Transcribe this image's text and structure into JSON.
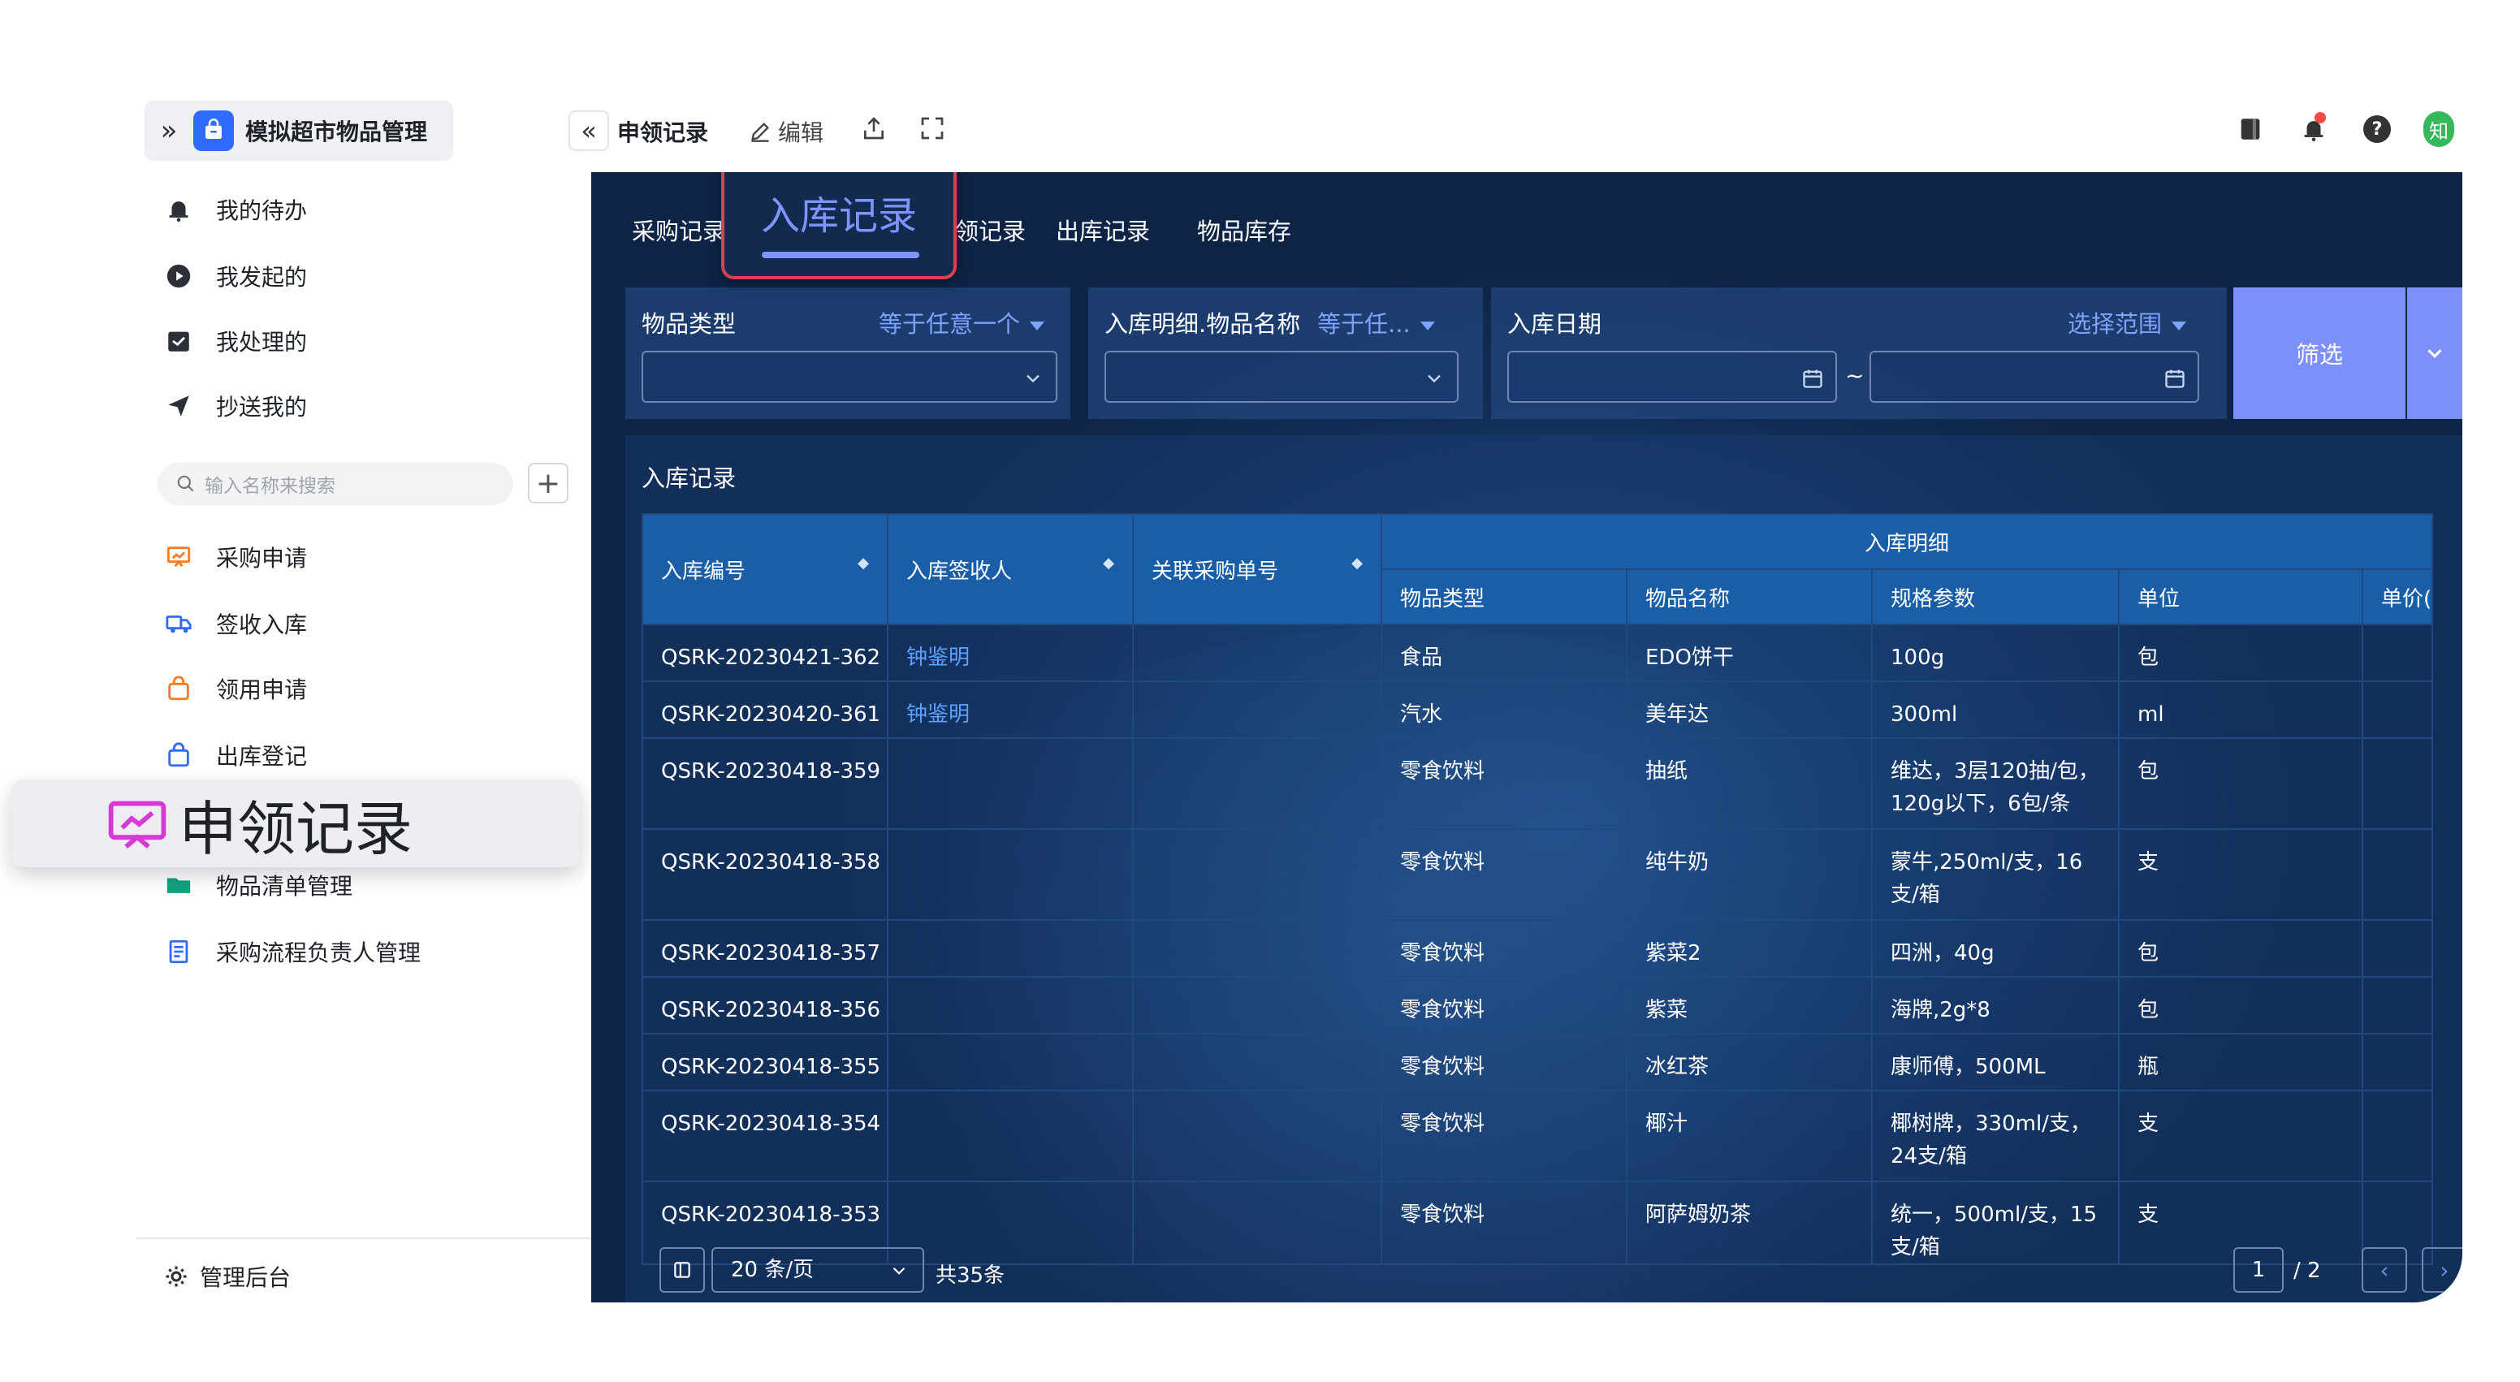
{
  "app": {
    "title": "模拟超市物品管理",
    "expand_icon": "double-chevron-right-icon"
  },
  "sidebar": {
    "top_items": [
      {
        "label": "我的待办",
        "icon": "bell-icon"
      },
      {
        "label": "我发起的",
        "icon": "play-circle-icon"
      },
      {
        "label": "我处理的",
        "icon": "inbox-check-icon"
      },
      {
        "label": "抄送我的",
        "icon": "send-icon"
      }
    ],
    "search_placeholder": "输入名称来搜索",
    "add_label": "+",
    "menu_items": [
      {
        "label": "采购申请",
        "icon": "presentation-icon"
      },
      {
        "label": "签收入库",
        "icon": "truck-icon"
      },
      {
        "label": "领用申请",
        "icon": "bag-icon"
      },
      {
        "label": "出库登记",
        "icon": "bag-out-icon"
      },
      {
        "label": "物品清单管理",
        "icon": "folder-icon"
      },
      {
        "label": "采购流程负责人管理",
        "icon": "document-icon"
      }
    ],
    "highlight_popup": {
      "label": "申领记录",
      "icon": "monitor-chart-icon"
    },
    "admin_label": "管理后台"
  },
  "toolbar": {
    "collapse_icon": "double-chevron-left-icon",
    "page_title": "申领记录",
    "edit_label": "编辑",
    "share_icon": "share-icon",
    "fullscreen_icon": "fullscreen-icon",
    "right_icons": [
      "book-icon",
      "notification-bell-icon",
      "help-icon",
      "avatar"
    ],
    "help_label": "?",
    "avatar_label": "知"
  },
  "tabs": {
    "items": [
      "采购记录",
      "申领记录",
      "出库记录",
      "物品库存"
    ],
    "partial_visible": "领记录",
    "active_popup": "入库记录"
  },
  "filters": {
    "f1": {
      "label": "物品类型",
      "op": "等于任意一个"
    },
    "f2": {
      "label": "入库明细.物品名称",
      "op": "等于任..."
    },
    "f3": {
      "label": "入库日期",
      "op": "选择范围",
      "range_sep": "~"
    },
    "button": "筛选"
  },
  "table": {
    "title": "入库记录",
    "columns": [
      "入库编号",
      "入库签收人",
      "关联采购单号"
    ],
    "group_header": "入库明细",
    "sub_columns": [
      "物品类型",
      "物品名称",
      "规格参数",
      "单位",
      "单价("
    ],
    "rows": [
      {
        "id": "QSRK-20230421-362",
        "receiver": "钟鉴明",
        "po": "",
        "type": "食品",
        "name": "EDO饼干",
        "spec": "100g",
        "unit": "包"
      },
      {
        "id": "QSRK-20230420-361",
        "receiver": "钟鉴明",
        "po": "",
        "type": "汽水",
        "name": "美年达",
        "spec": "300ml",
        "unit": "ml"
      },
      {
        "id": "QSRK-20230418-359",
        "receiver": "",
        "po": "",
        "type": "零食饮料",
        "name": "抽纸",
        "spec": "维达，3层120抽/包，120g以下，6包/条",
        "unit": "包"
      },
      {
        "id": "QSRK-20230418-358",
        "receiver": "",
        "po": "",
        "type": "零食饮料",
        "name": "纯牛奶",
        "spec": "蒙牛,250ml/支，16支/箱",
        "unit": "支"
      },
      {
        "id": "QSRK-20230418-357",
        "receiver": "",
        "po": "",
        "type": "零食饮料",
        "name": "紫菜2",
        "spec": "四洲，40g",
        "unit": "包"
      },
      {
        "id": "QSRK-20230418-356",
        "receiver": "",
        "po": "",
        "type": "零食饮料",
        "name": "紫菜",
        "spec": "海牌,2g*8",
        "unit": "包"
      },
      {
        "id": "QSRK-20230418-355",
        "receiver": "",
        "po": "",
        "type": "零食饮料",
        "name": "冰红茶",
        "spec": "康师傅，500ML",
        "unit": "瓶"
      },
      {
        "id": "QSRK-20230418-354",
        "receiver": "",
        "po": "",
        "type": "零食饮料",
        "name": "椰汁",
        "spec": "椰树牌，330ml/支，24支/箱",
        "unit": "支"
      },
      {
        "id": "QSRK-20230418-353",
        "receiver": "",
        "po": "",
        "type": "零食饮料",
        "name": "阿萨姆奶茶",
        "spec": "统一，500ml/支，15支/箱",
        "unit": "支"
      }
    ]
  },
  "pagination": {
    "page_size": "20 条/页",
    "total": "共35条",
    "page": "1",
    "page_total": "/ 2"
  },
  "colors": {
    "accent": "#7d8ff9",
    "link": "#5fa0ff",
    "panel": "#143a68",
    "header_row": "#1a5ea8",
    "popup_border": "#d9414d"
  }
}
